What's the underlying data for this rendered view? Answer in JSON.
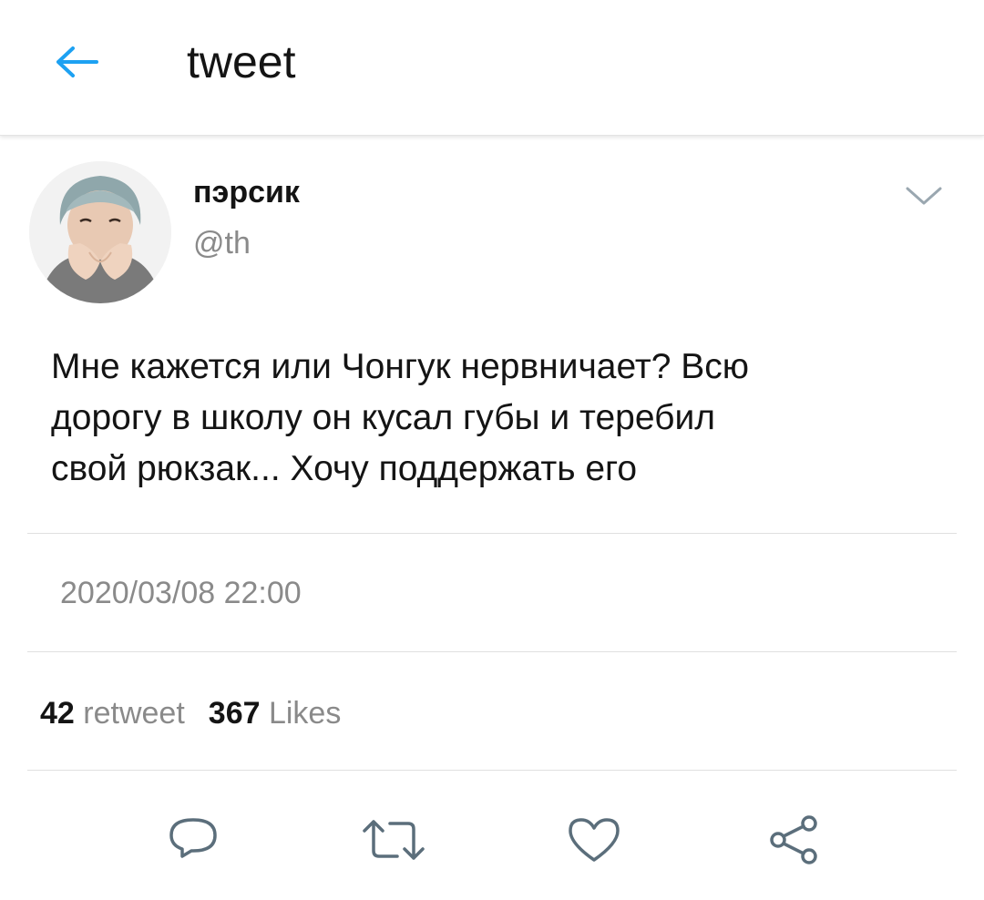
{
  "colors": {
    "accent": "#1da1f2",
    "icon_gray": "#5b6e7b",
    "secondary_text": "#8a8a8a"
  },
  "header": {
    "back_icon": "arrow-left-icon",
    "title": "tweet"
  },
  "tweet": {
    "author": {
      "display_name": "пэрсик",
      "handle": "@th"
    },
    "menu_icon": "chevron-down-icon",
    "text_lines": [
      "Мне кажется или Чонгук нервничает? Всю",
      "дорогу в школу он кусал губы и теребил",
      "свой рюкзак... Хочу поддержать его"
    ],
    "timestamp": "2020/03/08 22:00",
    "stats": {
      "retweets_count": "42",
      "retweets_label": "retweet",
      "likes_count": "367",
      "likes_label": "Likes"
    },
    "actions": [
      {
        "icon": "reply-icon"
      },
      {
        "icon": "retweet-icon"
      },
      {
        "icon": "heart-icon"
      },
      {
        "icon": "share-icon"
      }
    ]
  }
}
